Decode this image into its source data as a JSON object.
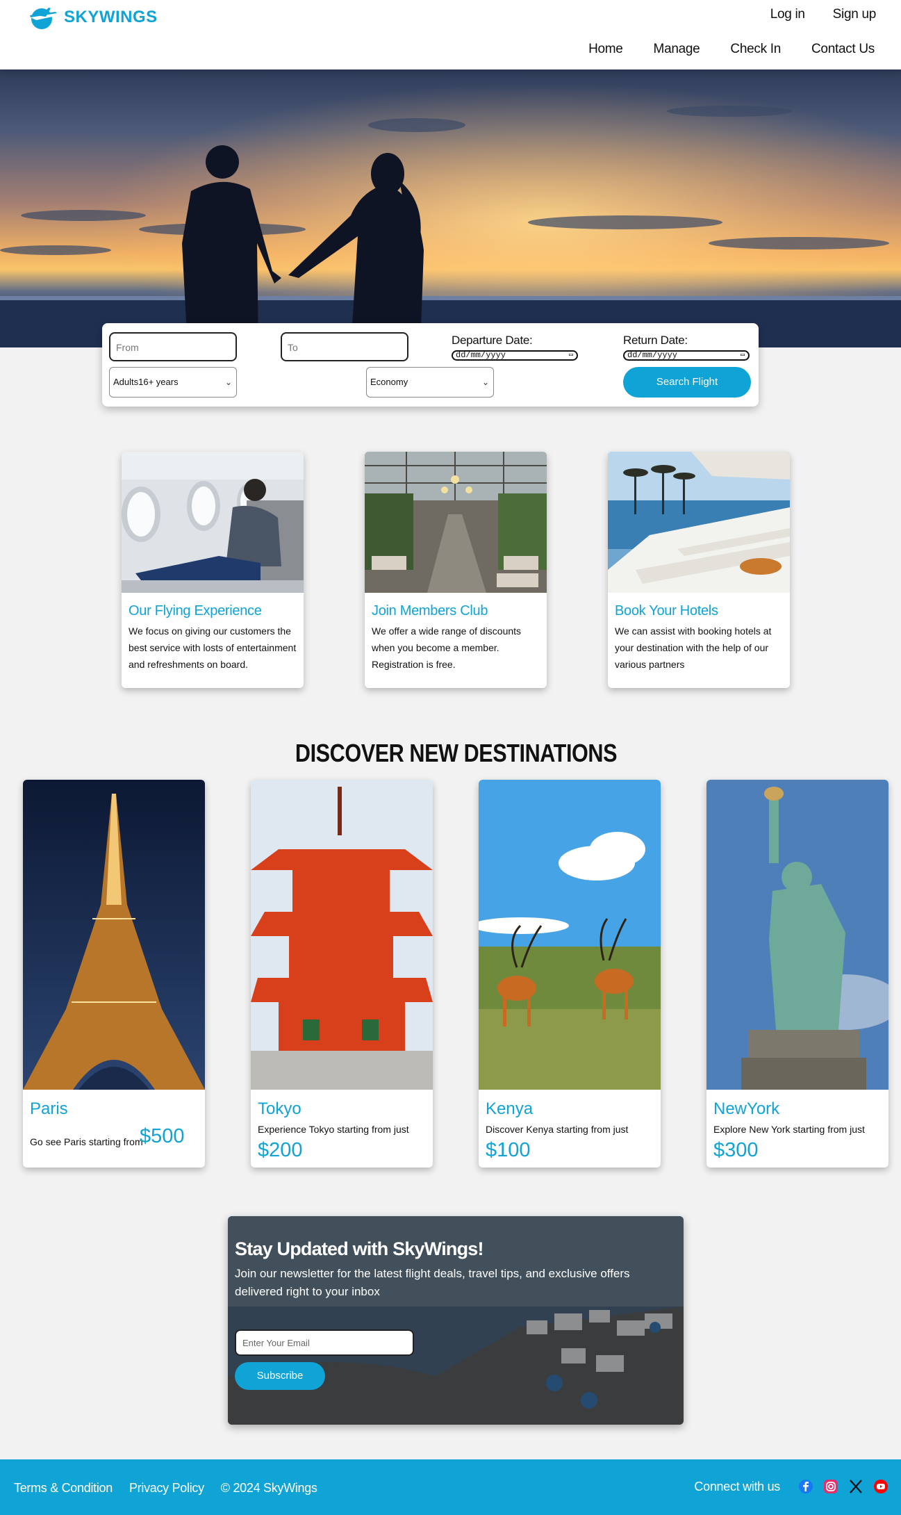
{
  "brand": {
    "name": "SKYWINGS",
    "accent": "#0fa3d6"
  },
  "header": {
    "auth": [
      "Log in",
      "Sign up"
    ],
    "nav": [
      "Home",
      "Manage",
      "Check In",
      "Contact Us"
    ]
  },
  "search": {
    "from_placeholder": "From",
    "to_placeholder": "To",
    "departure_label": "Departure Date:",
    "return_label": "Return Date:",
    "date_placeholder": "dd/mm/yyyy",
    "passengers_value": "Adults16+ years",
    "class_value": "Economy",
    "button": "Search Flight"
  },
  "features": [
    {
      "title": "Our Flying Experience",
      "text": "We focus on giving our customers the best service with losts of entertainment and refreshments on board."
    },
    {
      "title": "Join Members Club",
      "text": "We offer a wide range of discounts when you become a member. Registration is free."
    },
    {
      "title": "Book Your Hotels",
      "text": "We can assist with booking hotels at your destination with the help of our various partners"
    }
  ],
  "destinations": {
    "heading": "DISCOVER NEW DESTINATIONS",
    "items": [
      {
        "name": "Paris",
        "text": "Go see Paris starting from",
        "price": "$500"
      },
      {
        "name": "Tokyo",
        "text": "Experience Tokyo starting from just",
        "price": "$200"
      },
      {
        "name": "Kenya",
        "text": "Discover Kenya starting from just",
        "price": "$100"
      },
      {
        "name": "NewYork",
        "text": "Explore New York starting from just",
        "price": "$300"
      }
    ]
  },
  "newsletter": {
    "title": "Stay Updated with SkyWings!",
    "text": "Join our newsletter for the latest flight deals, travel tips, and exclusive offers delivered right to your inbox",
    "email_placeholder": "Enter Your Email",
    "button": "Subscribe"
  },
  "footer": {
    "links": [
      "Terms & Condition",
      "Privacy Policy",
      "© 2024 SkyWings"
    ],
    "connect": "Connect with us",
    "social_icons": [
      "facebook-icon",
      "instagram-icon",
      "x-icon",
      "youtube-icon"
    ]
  }
}
